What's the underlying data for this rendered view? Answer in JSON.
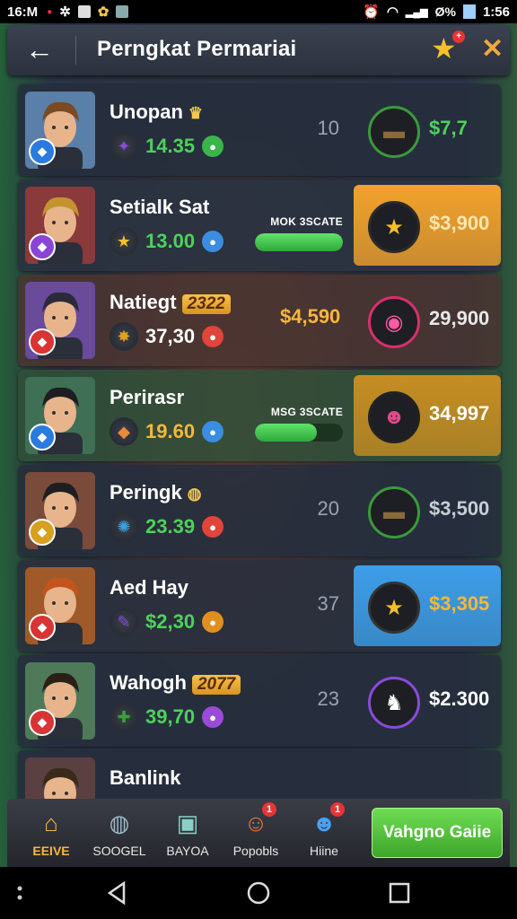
{
  "status": {
    "time": "16:M",
    "right_text": "Ø%",
    "right_time": "1:56"
  },
  "header": {
    "title": "Perngkat Permariai",
    "star_badge": "+"
  },
  "colors": {
    "accent_orange": "#f5b83a",
    "green": "#4cd25a",
    "bg": "#1b2230"
  },
  "rows": [
    {
      "name": "Unopan",
      "tag": "",
      "title_icon": "crown-icon",
      "stat": "14.35",
      "stat_color": "#4cd25a",
      "mid": "10",
      "mid_promo": "",
      "promo_fill": 0,
      "price": "$7,7",
      "price_color": "#4cd25a",
      "item_icon": "log-icon",
      "item_bg": "",
      "rank_color": "#2a7be0"
    },
    {
      "name": "Setialk Sat",
      "tag": "",
      "title_icon": "",
      "stat": "13.00",
      "stat_color": "#4cd25a",
      "mid": "",
      "mid_promo": "MOK 3SCATE",
      "promo_fill": 1.0,
      "price": "$3,900",
      "price_color": "#ffe7b0",
      "item_icon": "star-shield-icon",
      "item_bg": "#f2a22c",
      "rank_color": "#8a45d8"
    },
    {
      "name": "Natiegt",
      "tag": "2322",
      "title_icon": "",
      "stat": "37,30",
      "stat_color": "#ffffff",
      "mid": "$4,590",
      "mid_promo": "",
      "promo_fill": 0,
      "price": "29,900",
      "price_color": "#e8e8e8",
      "item_icon": "pink-gem-icon",
      "item_bg": "",
      "rank_color": "#d83434"
    },
    {
      "name": "Perirasr",
      "tag": "",
      "title_icon": "",
      "stat": "19.60",
      "stat_color": "#f5b83a",
      "mid": "",
      "mid_promo": "MSG 3SCATE",
      "promo_fill": 0.7,
      "price": "34,997",
      "price_color": "#ffffff",
      "item_icon": "demon-mask-icon",
      "item_bg": "#c68d22",
      "rank_color": "#2a7be0"
    },
    {
      "name": "Peringk",
      "tag": "",
      "title_icon": "globe-icon",
      "stat": "23.39",
      "stat_color": "#4cd25a",
      "mid": "20",
      "mid_promo": "",
      "promo_fill": 0,
      "price": "$3,500",
      "price_color": "#c9cdd6",
      "item_icon": "log-icon",
      "item_bg": "",
      "rank_color": "#d8a020"
    },
    {
      "name": "Aed Hay",
      "tag": "",
      "title_icon": "",
      "stat": "$2,30",
      "stat_color": "#4cd25a",
      "mid": "37",
      "mid_promo": "",
      "promo_fill": 0,
      "price": "$3,305",
      "price_color": "#f5b83a",
      "item_icon": "gold-star-icon",
      "item_bg": "#3d9ee8",
      "rank_color": "#d83434"
    },
    {
      "name": "Wahogh",
      "tag": "2077",
      "title_icon": "",
      "stat": "39,70",
      "stat_color": "#4cd25a",
      "mid": "23",
      "mid_promo": "",
      "promo_fill": 0,
      "price": "$2.300",
      "price_color": "#ffffff",
      "item_icon": "unicorn-icon",
      "item_bg": "",
      "rank_color": "#d83434"
    },
    {
      "name": "Banlink",
      "tag": "",
      "title_icon": "",
      "stat": "",
      "stat_color": "#4cd25a",
      "mid": "",
      "mid_promo": "",
      "promo_fill": 0,
      "price": "",
      "price_color": "#ffffff",
      "item_icon": "",
      "item_bg": "",
      "rank_color": "#d83434"
    }
  ],
  "nav": {
    "items": [
      {
        "label": "EEIVE",
        "icon": "home-icon",
        "active": true
      },
      {
        "label": "SOOGEL",
        "icon": "globe-icon",
        "active": false
      },
      {
        "label": "BAYOA",
        "icon": "chest-icon",
        "active": false
      },
      {
        "label": "Popobls",
        "icon": "character-icon",
        "active": false,
        "badge": "1"
      },
      {
        "label": "Hiine",
        "icon": "hero-icon",
        "active": false,
        "badge": "1"
      }
    ],
    "play_label": "Vahgno Gaiie"
  }
}
